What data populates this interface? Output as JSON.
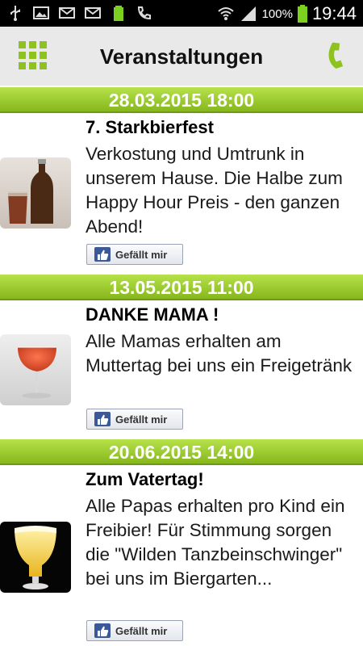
{
  "status_bar": {
    "battery": "100%",
    "time": "19:44",
    "icons": [
      "usb-icon",
      "image-icon",
      "email-icon",
      "email-icon",
      "battery-icon",
      "missed-call-icon",
      "wifi-icon",
      "signal-icon"
    ]
  },
  "header": {
    "title": "Veranstaltungen",
    "menu_icon": "grid-menu-icon",
    "call_icon": "phone-icon",
    "accent_color": "#8dc21f"
  },
  "events": [
    {
      "date": "28.03.2015 18:00",
      "title": "7. Starkbierfest",
      "description": "Verkostung und Umtrunk in unserem Hause. Die Halbe zum Happy Hour Preis - den ganzen Abend!",
      "like_label": "Gefällt mir",
      "image": "beer-bottle-photo"
    },
    {
      "date": "13.05.2015 11:00",
      "title": "DANKE MAMA !",
      "description": "Alle Mamas erhalten am Muttertag bei uns ein Freigetränk",
      "like_label": "Gefällt mir",
      "image": "red-drink-glass-photo"
    },
    {
      "date": "20.06.2015 14:00",
      "title": "Zum Vatertag!",
      "description": "Alle Papas erhalten pro Kind ein Freibier! Für Stimmung sorgen die \"Wilden Tanzbeinschwinger\" bei uns im Biergarten...",
      "like_label": "Gefällt mir",
      "image": "beer-glass-photo"
    }
  ]
}
